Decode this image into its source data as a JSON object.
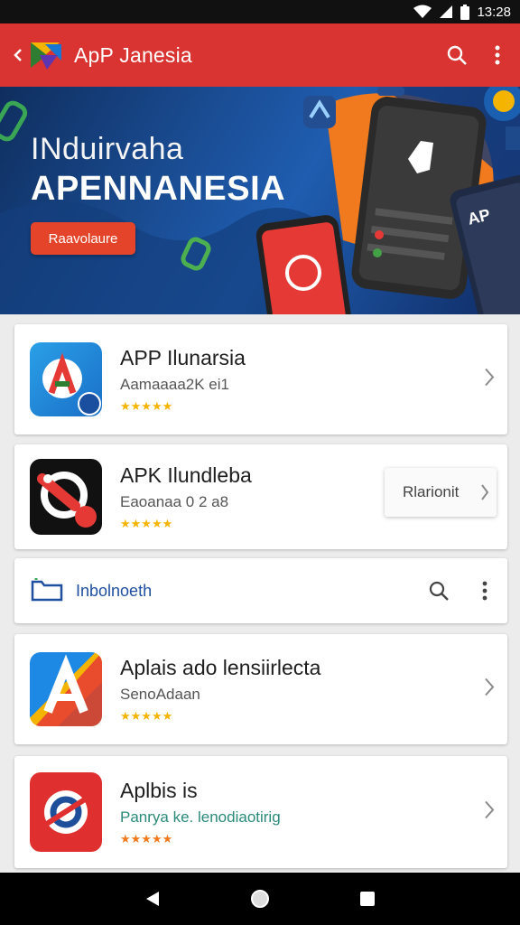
{
  "status": {
    "time": "13:28"
  },
  "app": {
    "title": "ApP Janesia"
  },
  "banner": {
    "line1": "INduirvaha",
    "line2": "APENNANESIA",
    "button": "Raavolaure",
    "phone_text": "AP"
  },
  "cards": [
    {
      "name": "APP Ilunarsia",
      "sub": "Aamaaaa2K ei1",
      "stars": "★★★★★"
    },
    {
      "name": "APK Ilundleba",
      "sub": "Eaoanaa 0 2 a8",
      "stars": "★★★★★",
      "action": "Rlarionit"
    },
    {
      "section": "Inbolnoeth"
    },
    {
      "name": "Aplais ado lensiirlecta",
      "sub": "SenoAdaan",
      "stars": "★★★★★"
    },
    {
      "name": "Aplbis is",
      "sub": "Panrya ke. lenodiaotirig",
      "stars": "★★★★★"
    }
  ],
  "colors": {
    "accent": "#d93431",
    "star": "#f5b400",
    "section_text": "#1f4fa0"
  }
}
